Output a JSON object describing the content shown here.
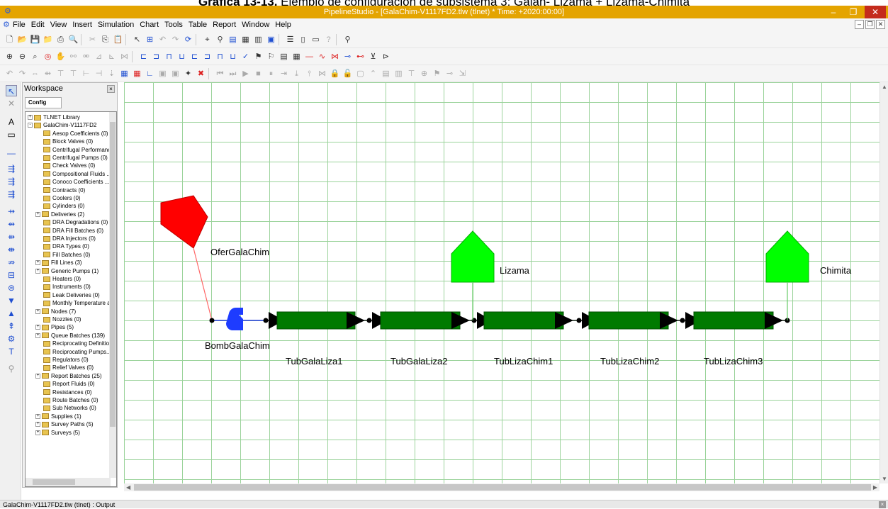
{
  "caption": {
    "bold": "Gráfica 13-13.",
    "rest": " Ejemplo de configuración de subsistema 3: Galán- Lizama + Lizama-Chimita"
  },
  "window": {
    "title": "PipelineStudio - [GalaChim-V1117FD2.tlw (tlnet) * Time: +2020:00:00]"
  },
  "menu": [
    "File",
    "Edit",
    "View",
    "Insert",
    "Simulation",
    "Chart",
    "Tools",
    "Table",
    "Report",
    "Window",
    "Help"
  ],
  "workspace": {
    "title": "Workspace",
    "tab": "Config",
    "tree": [
      {
        "label": "TLNET Library",
        "level": 0,
        "expander": "+"
      },
      {
        "label": "GalaChim-V1117FD2",
        "level": 0,
        "expander": "-"
      },
      {
        "label": "Aesop Coefficients (0)",
        "level": 1
      },
      {
        "label": "Block Valves (0)",
        "level": 1
      },
      {
        "label": "Centrifugal Performance",
        "level": 1
      },
      {
        "label": "Centrifugal Pumps (0)",
        "level": 1
      },
      {
        "label": "Check Valves (0)",
        "level": 1
      },
      {
        "label": "Compositional Fluids ...",
        "level": 1
      },
      {
        "label": "Conoco Coefficients ...",
        "level": 1
      },
      {
        "label": "Contracts (0)",
        "level": 1
      },
      {
        "label": "Coolers (0)",
        "level": 1
      },
      {
        "label": "Cylinders (0)",
        "level": 1
      },
      {
        "label": "Deliveries (2)",
        "level": 1,
        "expander": "+"
      },
      {
        "label": "DRA Degradations (0)",
        "level": 1
      },
      {
        "label": "DRA Fill Batches (0)",
        "level": 1
      },
      {
        "label": "DRA Injectors (0)",
        "level": 1
      },
      {
        "label": "DRA Types (0)",
        "level": 1
      },
      {
        "label": "Fill Batches (0)",
        "level": 1
      },
      {
        "label": "Fill Lines (3)",
        "level": 1,
        "expander": "+"
      },
      {
        "label": "Generic Pumps (1)",
        "level": 1,
        "expander": "+"
      },
      {
        "label": "Heaters (0)",
        "level": 1
      },
      {
        "label": "Instruments (0)",
        "level": 1
      },
      {
        "label": "Leak Deliveries (0)",
        "level": 1
      },
      {
        "label": "Monthly Temperature ar",
        "level": 1
      },
      {
        "label": "Nodes (7)",
        "level": 1,
        "expander": "+"
      },
      {
        "label": "Nozzles (0)",
        "level": 1
      },
      {
        "label": "Pipes (5)",
        "level": 1,
        "expander": "+"
      },
      {
        "label": "Queue Batches (139)",
        "level": 1,
        "expander": "+"
      },
      {
        "label": "Reciprocating Definition",
        "level": 1
      },
      {
        "label": "Reciprocating Pumps...",
        "level": 1
      },
      {
        "label": "Regulators (0)",
        "level": 1
      },
      {
        "label": "Relief Valves (0)",
        "level": 1
      },
      {
        "label": "Report Batches (25)",
        "level": 1,
        "expander": "+"
      },
      {
        "label": "Report Fluids (0)",
        "level": 1
      },
      {
        "label": "Resistances (0)",
        "level": 1
      },
      {
        "label": "Route Batches (0)",
        "level": 1
      },
      {
        "label": "Sub Networks (0)",
        "level": 1
      },
      {
        "label": "Supplies (1)",
        "level": 1,
        "expander": "+"
      },
      {
        "label": "Survey Paths (5)",
        "level": 1,
        "expander": "+"
      },
      {
        "label": "Surveys (5)",
        "level": 1,
        "expander": "+"
      }
    ]
  },
  "diagram": {
    "supply": {
      "label": "OferGalaChim",
      "color": "#ff0000"
    },
    "pump": {
      "label": "BombGalaChim",
      "color": "#1e3cff"
    },
    "deliveries": [
      {
        "label": "Lizama",
        "color": "#00ff00"
      },
      {
        "label": "Chimita",
        "color": "#00ff00"
      }
    ],
    "pipe_color": "#007a00",
    "pipes": [
      "TubGalaLiza1",
      "TubGalaLiza2",
      "TubLizaChim1",
      "TubLizaChim2",
      "TubLizaChim3"
    ]
  },
  "status": {
    "text": "GalaChim-V1117FD2.tlw (tlnet) : Output"
  }
}
